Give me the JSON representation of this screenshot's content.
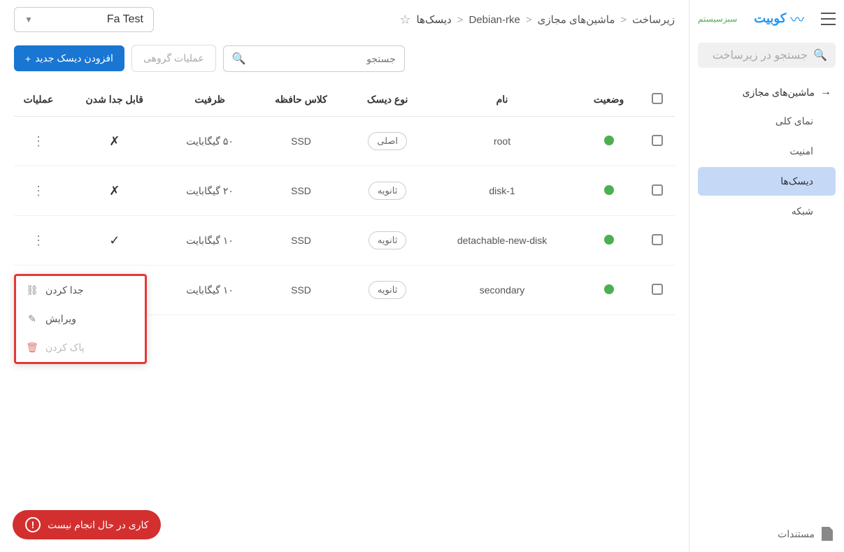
{
  "brand": {
    "name": "کوبیت",
    "secondary": "سبزسیستم"
  },
  "sidebar": {
    "search_placeholder": "جستجو در زیرساخت",
    "nav_header": "ماشین‌های مجازی",
    "items": [
      {
        "label": "نمای کلی"
      },
      {
        "label": "امنیت"
      },
      {
        "label": "دیسک‌ها"
      },
      {
        "label": "شبکه"
      }
    ],
    "footer": "مستندات"
  },
  "breadcrumb": {
    "items": [
      "زیرساخت",
      "ماشین‌های مجازی",
      "Debian-rke",
      "دیسک‌ها"
    ]
  },
  "project_select": {
    "value": "Fa Test"
  },
  "toolbar": {
    "add_label": "افزودن دیسک جدید",
    "bulk_label": "عملیات گروهی",
    "search_placeholder": "جستجو"
  },
  "table": {
    "headers": {
      "status": "وضعیت",
      "name": "نام",
      "disk_type": "نوع دیسک",
      "storage_class": "کلاس حافظه",
      "capacity": "ظرفیت",
      "detachable": "قابل جدا شدن",
      "actions": "عملیات"
    },
    "rows": [
      {
        "name": "root",
        "disk_type": "اصلی",
        "storage_class": "SSD",
        "capacity": "۵۰ گیگابایت",
        "detachable": false
      },
      {
        "name": "disk-1",
        "disk_type": "ثانویه",
        "storage_class": "SSD",
        "capacity": "۲۰ گیگابایت",
        "detachable": false
      },
      {
        "name": "detachable-new-disk",
        "disk_type": "ثانویه",
        "storage_class": "SSD",
        "capacity": "۱۰ گیگابایت",
        "detachable": true
      },
      {
        "name": "secondary",
        "disk_type": "ثانویه",
        "storage_class": "SSD",
        "capacity": "۱۰ گیگابایت",
        "detachable": true
      }
    ]
  },
  "context_menu": {
    "detach": "جدا کردن",
    "edit": "ویرایش",
    "delete": "پاک کردن"
  },
  "status_pill": "کاری در حال انجام نیست"
}
